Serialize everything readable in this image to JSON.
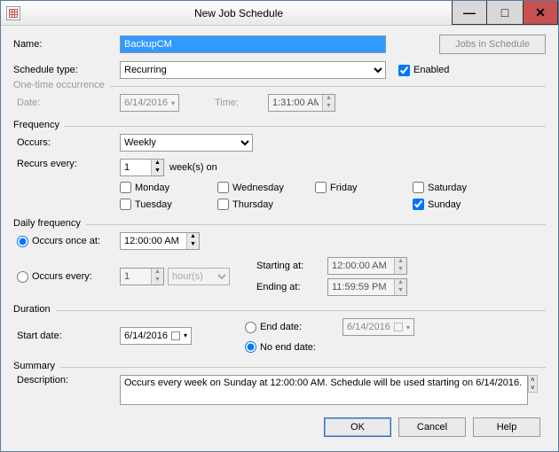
{
  "window": {
    "title": "New Job Schedule"
  },
  "top": {
    "name_label": "Name:",
    "name_value": "BackupCM",
    "jobs_btn": "Jobs in Schedule",
    "type_label": "Schedule type:",
    "type_value": "Recurring",
    "enabled_label": "Enabled"
  },
  "onetime": {
    "legend": "One-time occurrence",
    "date_label": "Date:",
    "date_value": "6/14/2016",
    "time_label": "Time:",
    "time_value": "1:31:00 AM"
  },
  "freq": {
    "legend": "Frequency",
    "occurs_label": "Occurs:",
    "occurs_value": "Weekly",
    "recurs_label": "Recurs every:",
    "recurs_value": "1",
    "recurs_suffix": "week(s) on",
    "days": {
      "mon": "Monday",
      "tue": "Tuesday",
      "wed": "Wednesday",
      "thu": "Thursday",
      "fri": "Friday",
      "sat": "Saturday",
      "sun": "Sunday"
    }
  },
  "daily": {
    "legend": "Daily frequency",
    "once_label": "Occurs once at:",
    "once_value": "12:00:00 AM",
    "every_label": "Occurs every:",
    "every_count": "1",
    "every_unit": "hour(s)",
    "start_label": "Starting at:",
    "start_value": "12:00:00 AM",
    "end_label": "Ending at:",
    "end_value": "11:59:59 PM"
  },
  "duration": {
    "legend": "Duration",
    "start_label": "Start date:",
    "start_value": "6/14/2016",
    "enddate_label": "End date:",
    "enddate_value": "6/14/2016",
    "noend_label": "No end date:"
  },
  "summary": {
    "legend": "Summary",
    "desc_label": "Description:",
    "desc_value": "Occurs every week on Sunday at 12:00:00 AM. Schedule will be used starting on 6/14/2016."
  },
  "buttons": {
    "ok": "OK",
    "cancel": "Cancel",
    "help": "Help"
  }
}
